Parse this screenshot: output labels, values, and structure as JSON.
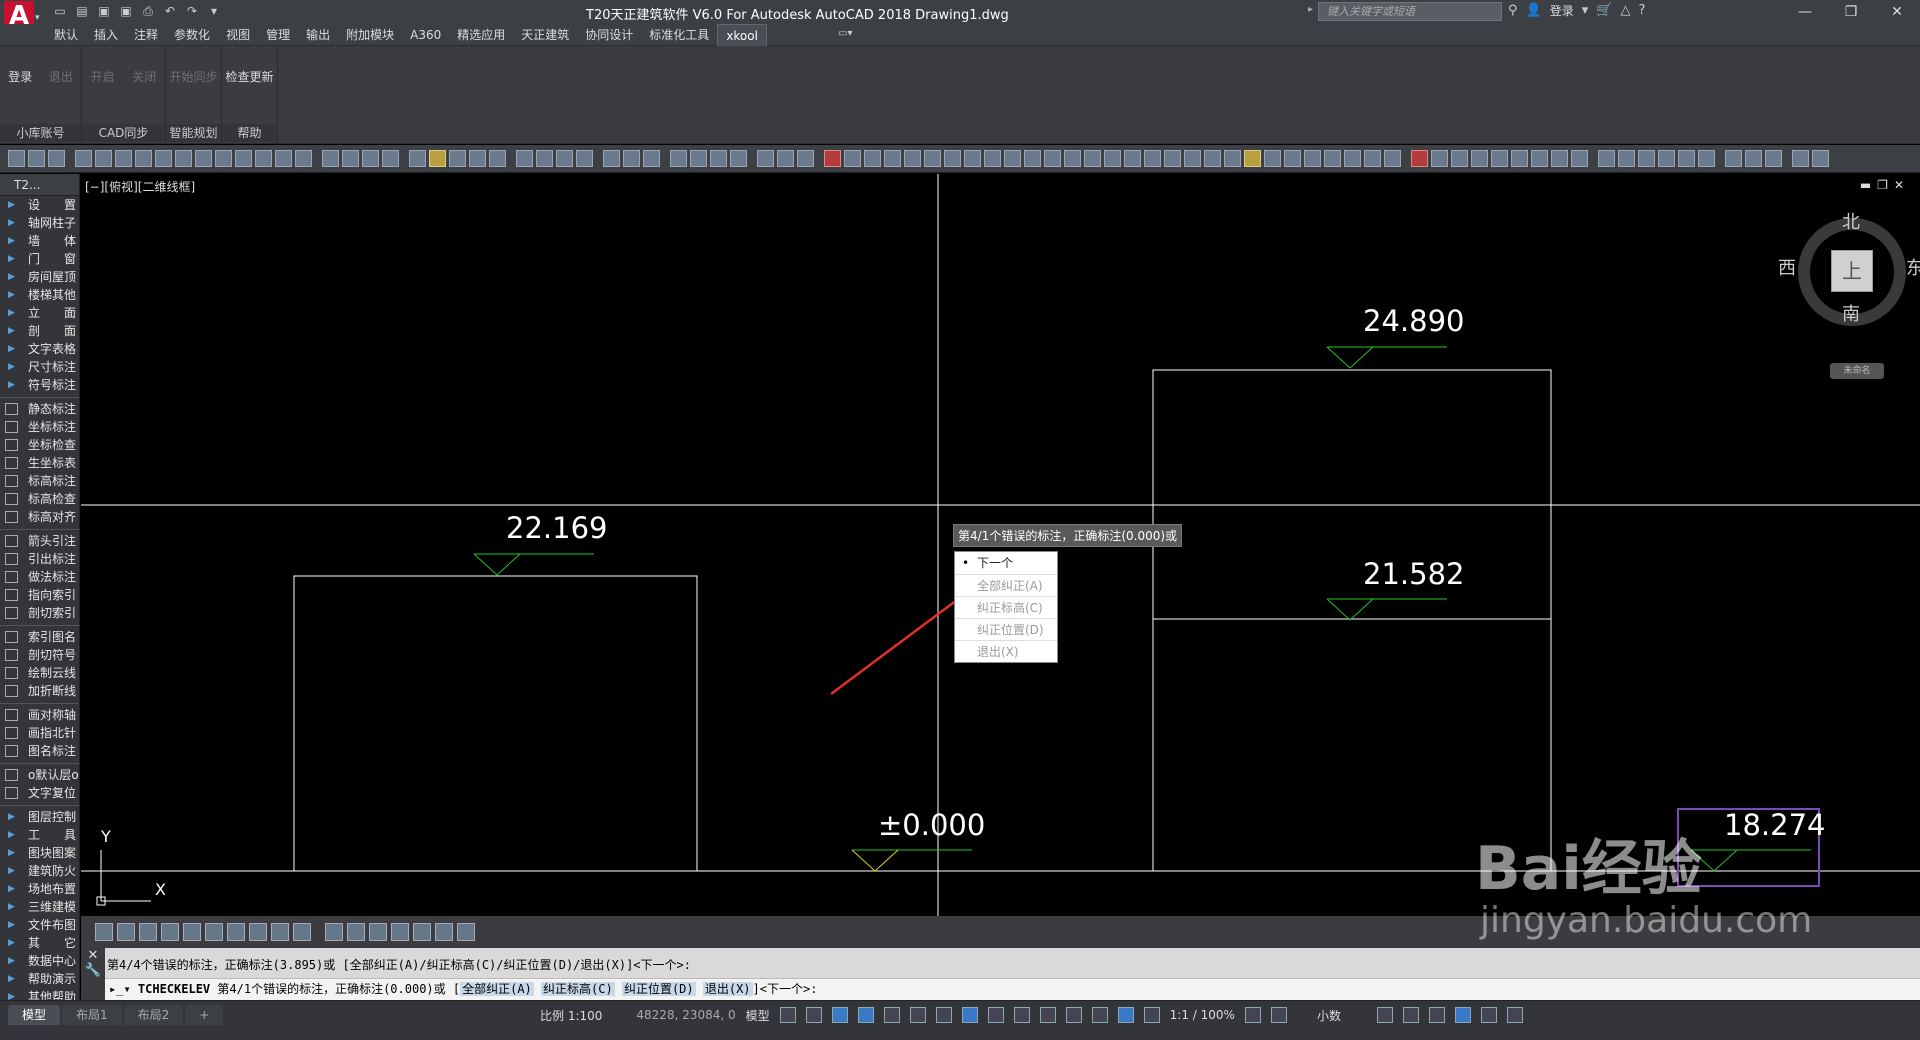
{
  "app": {
    "logo_letter": "A",
    "title": "T20天正建筑软件 V6.0 For Autodesk AutoCAD 2018    Drawing1.dwg",
    "search_placeholder": "键入关键字或短语",
    "login_label": "登录"
  },
  "ribbon_tabs": [
    "默认",
    "插入",
    "注释",
    "参数化",
    "视图",
    "管理",
    "输出",
    "附加模块",
    "A360",
    "精选应用",
    "天正建筑",
    "协同设计",
    "标准化工具",
    "xkool"
  ],
  "active_tab": "xkool",
  "ribbon_panels": [
    {
      "name": "小库账号",
      "buttons": [
        {
          "label": "登录",
          "enabled": true
        },
        {
          "label": "退出",
          "enabled": false
        }
      ]
    },
    {
      "name": "CAD同步",
      "buttons": [
        {
          "label": "开启",
          "enabled": false
        },
        {
          "label": "关闭",
          "enabled": false
        }
      ]
    },
    {
      "name": "智能规划",
      "buttons": [
        {
          "label": "开始同步",
          "enabled": false
        }
      ]
    },
    {
      "name": "帮助",
      "buttons": [
        {
          "label": "检查更新",
          "enabled": true
        }
      ]
    }
  ],
  "sidebar": {
    "header": "T2...",
    "items": [
      "设　　置",
      "轴网柱子",
      "墙　　体",
      "门　　窗",
      "房间屋顶",
      "楼梯其他",
      "立　　面",
      "剖　　面",
      "文字表格",
      "尺寸标注",
      "符号标注",
      "静态标注",
      "坐标标注",
      "坐标检查",
      "生坐标表",
      "标高标注",
      "标高检查",
      "标高对齐",
      "箭头引注",
      "引出标注",
      "做法标注",
      "指向索引",
      "剖切索引",
      "索引图名",
      "剖切符号",
      "绘制云线",
      "加折断线",
      "画对称轴",
      "画指北针",
      "图名标注",
      "o默认层o",
      "文字复位",
      "图层控制",
      "工　　具",
      "图块图案",
      "建筑防火",
      "场地布置",
      "三维建模",
      "文件布图",
      "其　　它",
      "数据中心",
      "帮助演示",
      "其他帮助"
    ]
  },
  "viewport": {
    "label": "[−][俯视][二维线框]",
    "viewcube": {
      "north": "北",
      "south": "南",
      "east": "东",
      "west": "西",
      "face": "上",
      "wcs": "未命名"
    },
    "ucs": {
      "x": "X",
      "y": "Y"
    },
    "tooltip": "第4/1个错误的标注，正确标注(0.000)或",
    "menu": [
      {
        "label": "下一个",
        "enabled": true,
        "selected": true
      },
      {
        "label": "全部纠正(A)",
        "enabled": false
      },
      {
        "label": "纠正标高(C)",
        "enabled": false
      },
      {
        "label": "纠正位置(D)",
        "enabled": false
      },
      {
        "label": "退出(X)",
        "enabled": false
      }
    ],
    "elevations": {
      "e1": "24.890",
      "e2": "22.169",
      "e3": "21.582",
      "e4": "±0.000",
      "e5": "18.274"
    },
    "colors": {
      "mark_green": "#22c422",
      "mark_yellow": "#e0d020",
      "highlight_box": "#7a4ab8",
      "arrow": "#e0302a"
    }
  },
  "command": {
    "history": "第4/4个错误的标注，正确标注(3.895)或 [全部纠正(A)/纠正标高(C)/纠正位置(D)/退出(X)]<下一个>:",
    "line_cmd": "TCHECKELEV",
    "line_text": "第4/1个错误的标注，正确标注(0.000)或 [",
    "line_opts": [
      "全部纠正(A)",
      "纠正标高(C)",
      "纠正位置(D)",
      "退出(X)"
    ],
    "line_end": "]<下一个>:"
  },
  "status": {
    "layout_tabs": [
      "模型",
      "布局1",
      "布局2"
    ],
    "add_tab": "+",
    "scale": "比例 1:100",
    "coords": "48228, 23084, 0",
    "model_label": "模型",
    "annotation_scale": "1:1 / 100%",
    "units": "小数"
  },
  "watermark": {
    "main": "Bai经验",
    "sub": "jingyan.baidu.com"
  }
}
